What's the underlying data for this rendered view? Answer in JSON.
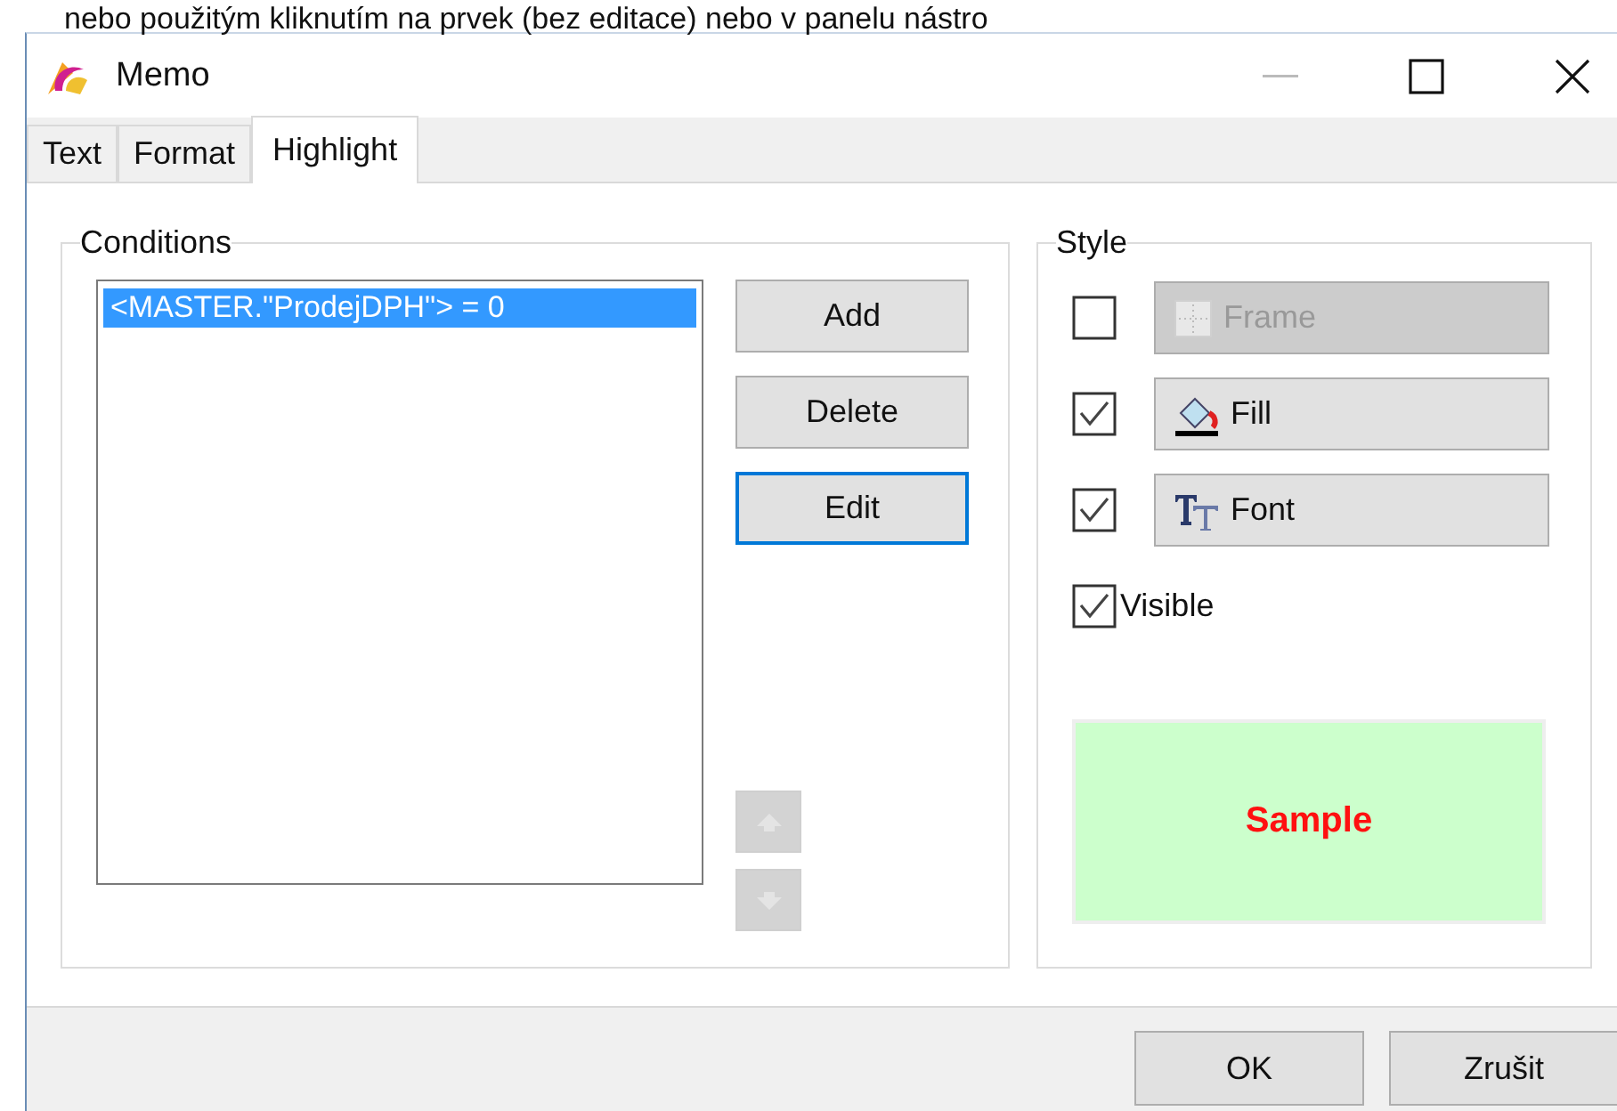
{
  "page_text": "nebo použitým kliknutím na prvek (bez editace) nebo v panelu nástro",
  "window": {
    "title": "Memo"
  },
  "tabs": [
    {
      "label": "Text",
      "selected": false
    },
    {
      "label": "Format",
      "selected": false
    },
    {
      "label": "Highlight",
      "selected": true
    }
  ],
  "conditions": {
    "title": "Conditions",
    "items": [
      {
        "text": "<MASTER.\"ProdejDPH\"> = 0",
        "selected": true
      }
    ],
    "buttons": [
      {
        "label": "Add",
        "focused": false
      },
      {
        "label": "Delete",
        "focused": false
      },
      {
        "label": "Edit",
        "focused": true
      }
    ],
    "move_buttons": [
      {
        "kind": "up",
        "disabled": true
      },
      {
        "kind": "down",
        "disabled": true
      }
    ]
  },
  "style": {
    "title": "Style",
    "options": [
      {
        "kind": "frame",
        "label": "Frame",
        "checked": false
      },
      {
        "kind": "fill",
        "label": "Fill",
        "checked": true
      },
      {
        "kind": "font",
        "label": "Font",
        "checked": true
      }
    ],
    "visible": {
      "label": "Visible",
      "checked": true
    },
    "sample": {
      "text": "Sample"
    }
  },
  "dialog_buttons": [
    "OK",
    "Zrušit"
  ]
}
